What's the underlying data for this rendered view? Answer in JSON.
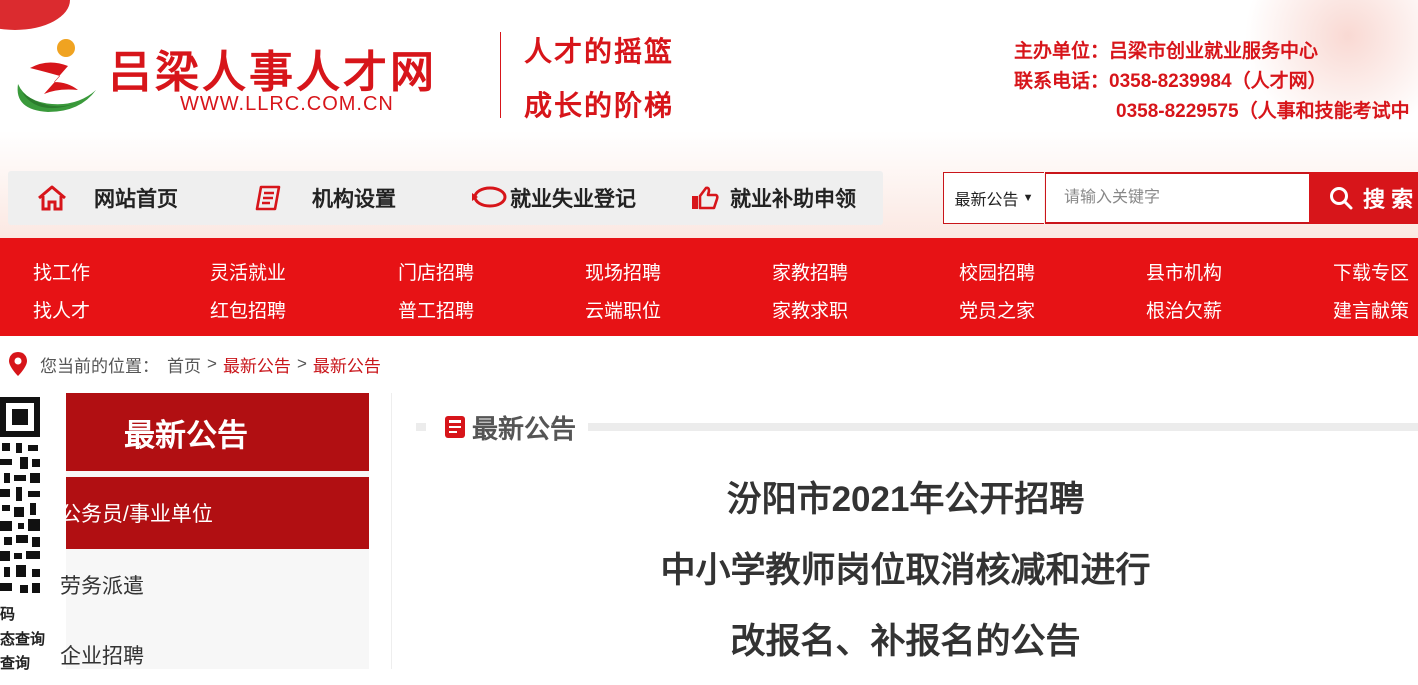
{
  "header": {
    "site_title": "吕梁人事人才网",
    "site_url": "WWW.LLRC.COM.CN",
    "slogan_1": "人才的摇篮",
    "slogan_2": "成长的阶梯",
    "host": "主办单位：吕梁市创业就业服务中心",
    "phone_1": "联系电话：0358-8239984（人才网）",
    "phone_2": "0358-8229575（人事和技能考试中"
  },
  "top_nav": [
    {
      "label": "网站首页",
      "icon": "home-icon"
    },
    {
      "label": "机构设置",
      "icon": "document-icon"
    },
    {
      "label": "就业失业登记",
      "icon": "chat-icon"
    },
    {
      "label": "就业补助申领",
      "icon": "thumb-up-icon"
    }
  ],
  "search": {
    "category": "最新公告",
    "placeholder": "请输入关键字",
    "button": "搜 索"
  },
  "red_nav": {
    "row1": [
      "找工作",
      "灵活就业",
      "门店招聘",
      "现场招聘",
      "家教招聘",
      "校园招聘",
      "县市机构",
      "下载专区"
    ],
    "row2": [
      "找人才",
      "红包招聘",
      "普工招聘",
      "云端职位",
      "家教求职",
      "党员之家",
      "根治欠薪",
      "建言献策"
    ]
  },
  "breadcrumb": {
    "label": "您当前的位置：",
    "home": "首页",
    "sep": ">",
    "level1": "最新公告",
    "level2": "最新公告"
  },
  "qr_side": {
    "line1": "码",
    "line2": "态查询",
    "line3": "查询"
  },
  "sidebar": {
    "heading": "最新公告",
    "items": [
      "公务员/事业单位",
      "劳务派遣",
      "企业招聘"
    ]
  },
  "content": {
    "section_title": "最新公告",
    "article_title_lines": [
      "汾阳市2021年公开招聘",
      "中小学教师岗位取消核减和进行",
      "改报名、补报名的公告"
    ]
  },
  "colors": {
    "brand_red": "#e71215",
    "dark_red": "#b10f12",
    "logo_green": "#3a9a3b",
    "logo_orange": "#f0a321"
  }
}
